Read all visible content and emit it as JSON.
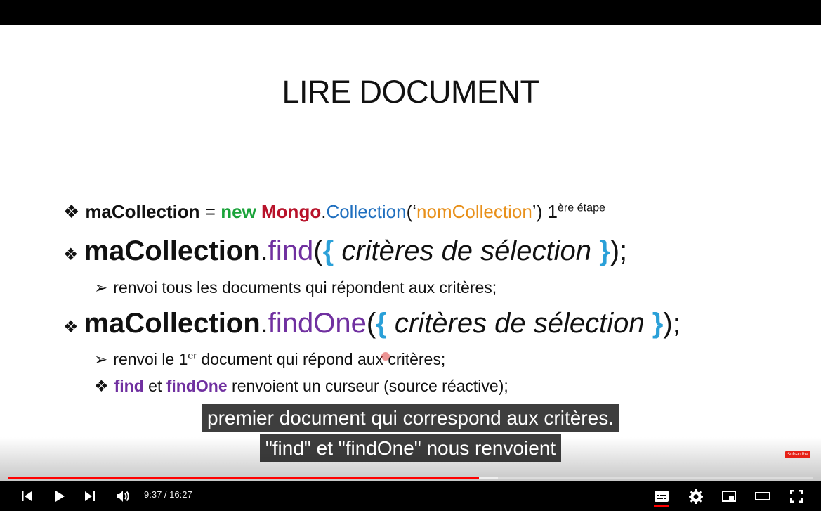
{
  "slide": {
    "title": "LIRE DOCUMENT",
    "line1": {
      "var": "maCollection",
      "eq": " = ",
      "new": "new",
      "mongo": "Mongo",
      "dot": ".",
      "collection": "Collection",
      "open": "(‘",
      "arg": "nomCollection",
      "close": "’) 1",
      "sup": "ère étape"
    },
    "line2": {
      "var": "maCollection",
      "dot": ".",
      "method": "find",
      "paren_open": "(",
      "brace_open": "{",
      "criteria": " critères de sélection ",
      "brace_close": "}",
      "paren_close": ");"
    },
    "sub1": "renvoi tous les documents qui répondent aux critères;",
    "line3": {
      "var": "maCollection",
      "dot": ".",
      "method": "findOne",
      "paren_open": "(",
      "brace_open": "{",
      "criteria": " critères de sélection ",
      "brace_close": "}",
      "paren_close": ");"
    },
    "sub2": {
      "pre": "renvoi le 1",
      "sup": "er",
      "post": " document qui répond aux critères;"
    },
    "sub3": {
      "find": "find",
      "and": " et ",
      "findOne": "findOne",
      "rest": " renvoient un curseur (source réactive);"
    }
  },
  "captions": {
    "line1": "premier document qui correspond aux critères.",
    "line2": "\"find\" et \"findOne\" nous renvoient"
  },
  "subscribe_badge": "Subscribe",
  "player": {
    "time_display": "9:37 / 16:27",
    "progress_played": 0.5853,
    "progress_buffered": 0.6085,
    "icons": {
      "prev": "skip-previous-icon",
      "play": "play-icon",
      "next": "skip-next-icon",
      "volume": "volume-icon",
      "captions": "captions-icon",
      "settings": "gear-icon",
      "miniplayer": "miniplayer-icon",
      "theater": "theater-mode-icon",
      "fullscreen": "fullscreen-icon"
    },
    "accent_color": "#ff0000"
  }
}
